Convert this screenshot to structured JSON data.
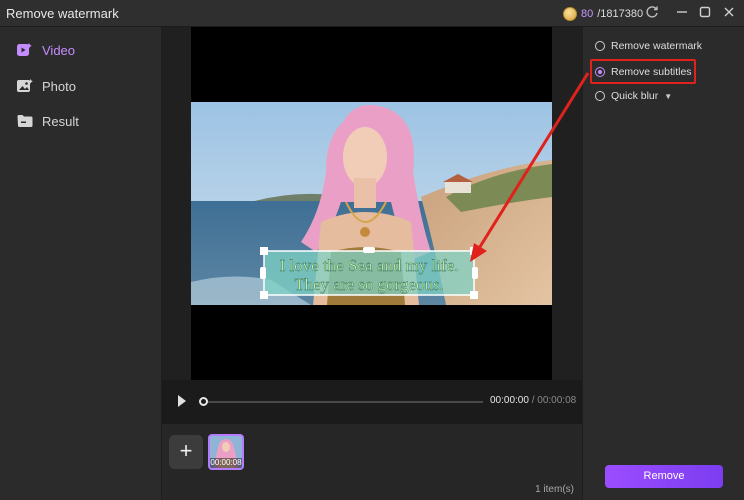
{
  "app": {
    "title": "Remove watermark"
  },
  "credits": {
    "used": "80",
    "total": "/1817380"
  },
  "sidebar": {
    "items": [
      {
        "label": "Video",
        "icon": "video-icon",
        "active": true
      },
      {
        "label": "Photo",
        "icon": "photo-icon",
        "active": false
      },
      {
        "label": "Result",
        "icon": "folder-icon",
        "active": false
      }
    ]
  },
  "video": {
    "subtitle_line1": "I love the Sea and my life.",
    "subtitle_line2": "They are so gorgeous.",
    "current_time": "00:00:00",
    "separator": "/",
    "duration": "00:00:08"
  },
  "timeline": {
    "add_label": "+",
    "clip_duration": "00:00:08",
    "item_count": "1 item(s)"
  },
  "panel": {
    "options": [
      {
        "label": "Remove watermark",
        "selected": false
      },
      {
        "label": "Remove subtitles",
        "selected": true
      },
      {
        "label": "Quick blur",
        "selected": false,
        "dropdown": true
      }
    ],
    "remove_label": "Remove"
  },
  "colors": {
    "accent": "#b57bff",
    "highlight": "#e0221c",
    "button": "#8b45f7"
  }
}
